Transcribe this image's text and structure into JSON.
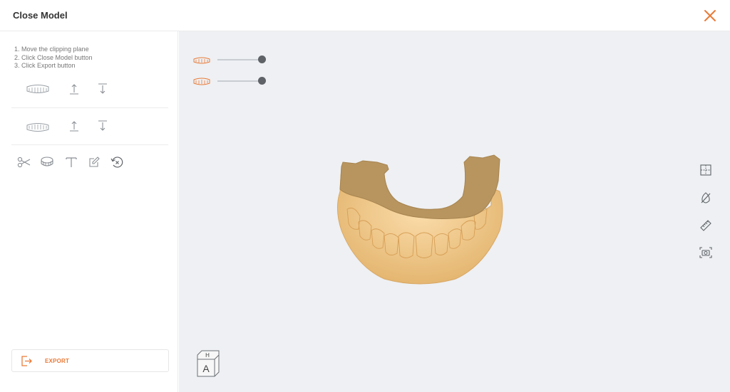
{
  "window": {
    "title": "Close Model",
    "close_icon": "close-icon"
  },
  "instructions": [
    "1. Move the clipping plane",
    "2. Click Close Model button",
    "3. Click Export button"
  ],
  "jaw_rows": [
    {
      "jaw": "upper-jaw",
      "icons": [
        "upper-jaw-icon",
        "move-up-icon",
        "move-down-icon"
      ]
    },
    {
      "jaw": "lower-jaw",
      "icons": [
        "lower-jaw-icon",
        "move-up-icon",
        "move-down-icon"
      ]
    }
  ],
  "tools": [
    "scissors-icon",
    "close-model-icon",
    "text-icon",
    "edit-icon",
    "reset-icon"
  ],
  "export": {
    "label": "EXPORT",
    "icon": "export-icon"
  },
  "viewport": {
    "opacity_sliders": [
      {
        "jaw": "upper-jaw",
        "value": 1.0
      },
      {
        "jaw": "lower-jaw",
        "value": 1.0
      }
    ],
    "right_tools": [
      "split-view-icon",
      "hide-icon",
      "ruler-icon",
      "screenshot-icon"
    ],
    "view_cube": {
      "top": "H",
      "front": "A"
    }
  },
  "colors": {
    "accent": "#e97a37",
    "viewport_bg": "#eef0f3",
    "model": "#f2c98a",
    "model_cut": "#b8955f"
  }
}
